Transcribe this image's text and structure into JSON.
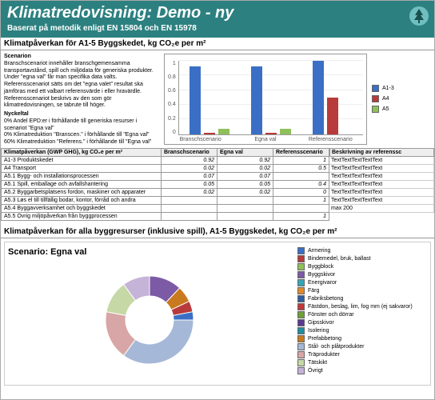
{
  "header": {
    "title": "Klimatredovisning: Demo - ny",
    "subtitle": "Baserat på metodik enligt EN 15804 och EN 15978"
  },
  "section1_title": "Klimatpåverkan för A1-5 Byggskedet, kg CO₂e per m²",
  "scenario_block": {
    "head": "Scenarion",
    "body": "Branschscenariot innehåller branschgemensamma transportavstånd, spill och miljödata för generiska produkter. Under \"egna val\" får man specifika data valts. Referensscenariot sätts om det \"egna valet\" resultat ska jämföras med ett valbart referensvärde i eller hravärdle. Referensscenariot beskrivs av den som gör klimatredovisningen, se tabrute till höger.",
    "nyckeltal_head": "Nyckeltal",
    "n1": "0% Andel EPD:er i förhållande till generiska resurser i scenariot \"Egna val\"",
    "n2": "0% Klimatreduktion \"Branscen.\" i förhållande till \"Egna val\"",
    "n3": "60% Klimatreduktion \"Referens.\" i förhållande till \"Egna val\""
  },
  "chart_data": {
    "type": "bar",
    "title": "",
    "ylim": [
      0,
      1
    ],
    "ticks": [
      0,
      0.2,
      0.4,
      0.6,
      0.8,
      1
    ],
    "categories": [
      "Branschscenario",
      "Egna val",
      "Referensscenario"
    ],
    "series": [
      {
        "name": "A1-3",
        "values": [
          0.92,
          0.92,
          1.0
        ]
      },
      {
        "name": "A4",
        "values": [
          0.02,
          0.02,
          0.5
        ]
      },
      {
        "name": "A5",
        "values": [
          0.07,
          0.07,
          0.0
        ]
      }
    ]
  },
  "table": {
    "headers": [
      "Klimatpåverkan (GWP GHG), kg CO₂e per m²",
      "Branschscenario",
      "Egna val",
      "Referensscenario"
    ],
    "rows": [
      [
        "A1-3 Produktskedet",
        "0.92",
        "0.92",
        "1"
      ],
      [
        "A4 Transport",
        "0.02",
        "0.02",
        "0.5"
      ],
      [
        "A5.1 Bygg- och installationsprocessen",
        "0.07",
        "0.07",
        ""
      ],
      [
        "A5.1 Spill, emballage och avfallshantering",
        "0.05",
        "0.05",
        "0.4"
      ],
      [
        "A5.2 Byggarbetsplatsens fordon, maskiner och apparater",
        "0.02",
        "0.02",
        "0"
      ],
      [
        "A5.3 Løs el till tillfällig bodar, kontor, förråd och andra",
        "",
        "",
        "1"
      ],
      [
        "A5.4 Byggavverksamhet och byggskedet",
        "",
        "",
        ""
      ],
      [
        "A5.5 Övrig miljöpåverkan från byggprocessen",
        "",
        "",
        "1"
      ]
    ],
    "desc_head": "Beskrivning av referenssc",
    "desc_rows": [
      "TextTextTextTextText",
      "TextTextTextTextText",
      "TextTextTextTextText",
      "TextTextTextTextText",
      "TextTextTextTextText",
      "TextTextTextTextText",
      "max 200"
    ]
  },
  "section2_title": "Klimatpåverkan för alla byggresurser (inklusive spill), A1-5 Byggskedet, kg CO₂e per m²",
  "donut": {
    "scenario_title": "Scenario: Egna val",
    "legend": [
      {
        "label": "Armering",
        "color": "#3a6fc5"
      },
      {
        "label": "Bindemedel, bruk, ballast",
        "color": "#b83a3a"
      },
      {
        "label": "Byggblock",
        "color": "#8fc05a"
      },
      {
        "label": "Byggskivor",
        "color": "#7d5aa6"
      },
      {
        "label": "Energivaror",
        "color": "#35a7b7"
      },
      {
        "label": "Färg",
        "color": "#e08a2a"
      },
      {
        "label": "Fabriksbetong",
        "color": "#2e5e9e"
      },
      {
        "label": "Fästdon, beslag, lim, fog mm (ej sakvaror)",
        "color": "#c13a3a"
      },
      {
        "label": "Fönster och dörrar",
        "color": "#6fa038"
      },
      {
        "label": "Gipsskivor",
        "color": "#5a3a8f"
      },
      {
        "label": "Isolering",
        "color": "#1f8f9f"
      },
      {
        "label": "Prefabbetong",
        "color": "#c97a1f"
      },
      {
        "label": "Stål- och plåtprodukter",
        "color": "#a6b8d8"
      },
      {
        "label": "Träprodukter",
        "color": "#d8a6a6"
      },
      {
        "label": "Tätskikt",
        "color": "#c6d8a6"
      },
      {
        "label": "Övrigt",
        "color": "#c6b3d8"
      }
    ],
    "chart_data": {
      "type": "pie",
      "title": "Scenario: Egna val",
      "slices": [
        {
          "name": "Byggskivor",
          "value": 12,
          "color": "#7d5aa6"
        },
        {
          "name": "Prefabbetong",
          "value": 6,
          "color": "#c97a1f"
        },
        {
          "name": "Bindemedel, bruk, ballast",
          "value": 4,
          "color": "#b83a3a"
        },
        {
          "name": "Armering",
          "value": 3,
          "color": "#3a6fc5"
        },
        {
          "name": "Stål- och plåtprodukter",
          "value": 35,
          "color": "#a6b8d8"
        },
        {
          "name": "Träprodukter",
          "value": 18,
          "color": "#d8a6a6"
        },
        {
          "name": "Tätskikt",
          "value": 12,
          "color": "#c6d8a6"
        },
        {
          "name": "Övrigt",
          "value": 10,
          "color": "#c6b3d8"
        }
      ]
    }
  }
}
